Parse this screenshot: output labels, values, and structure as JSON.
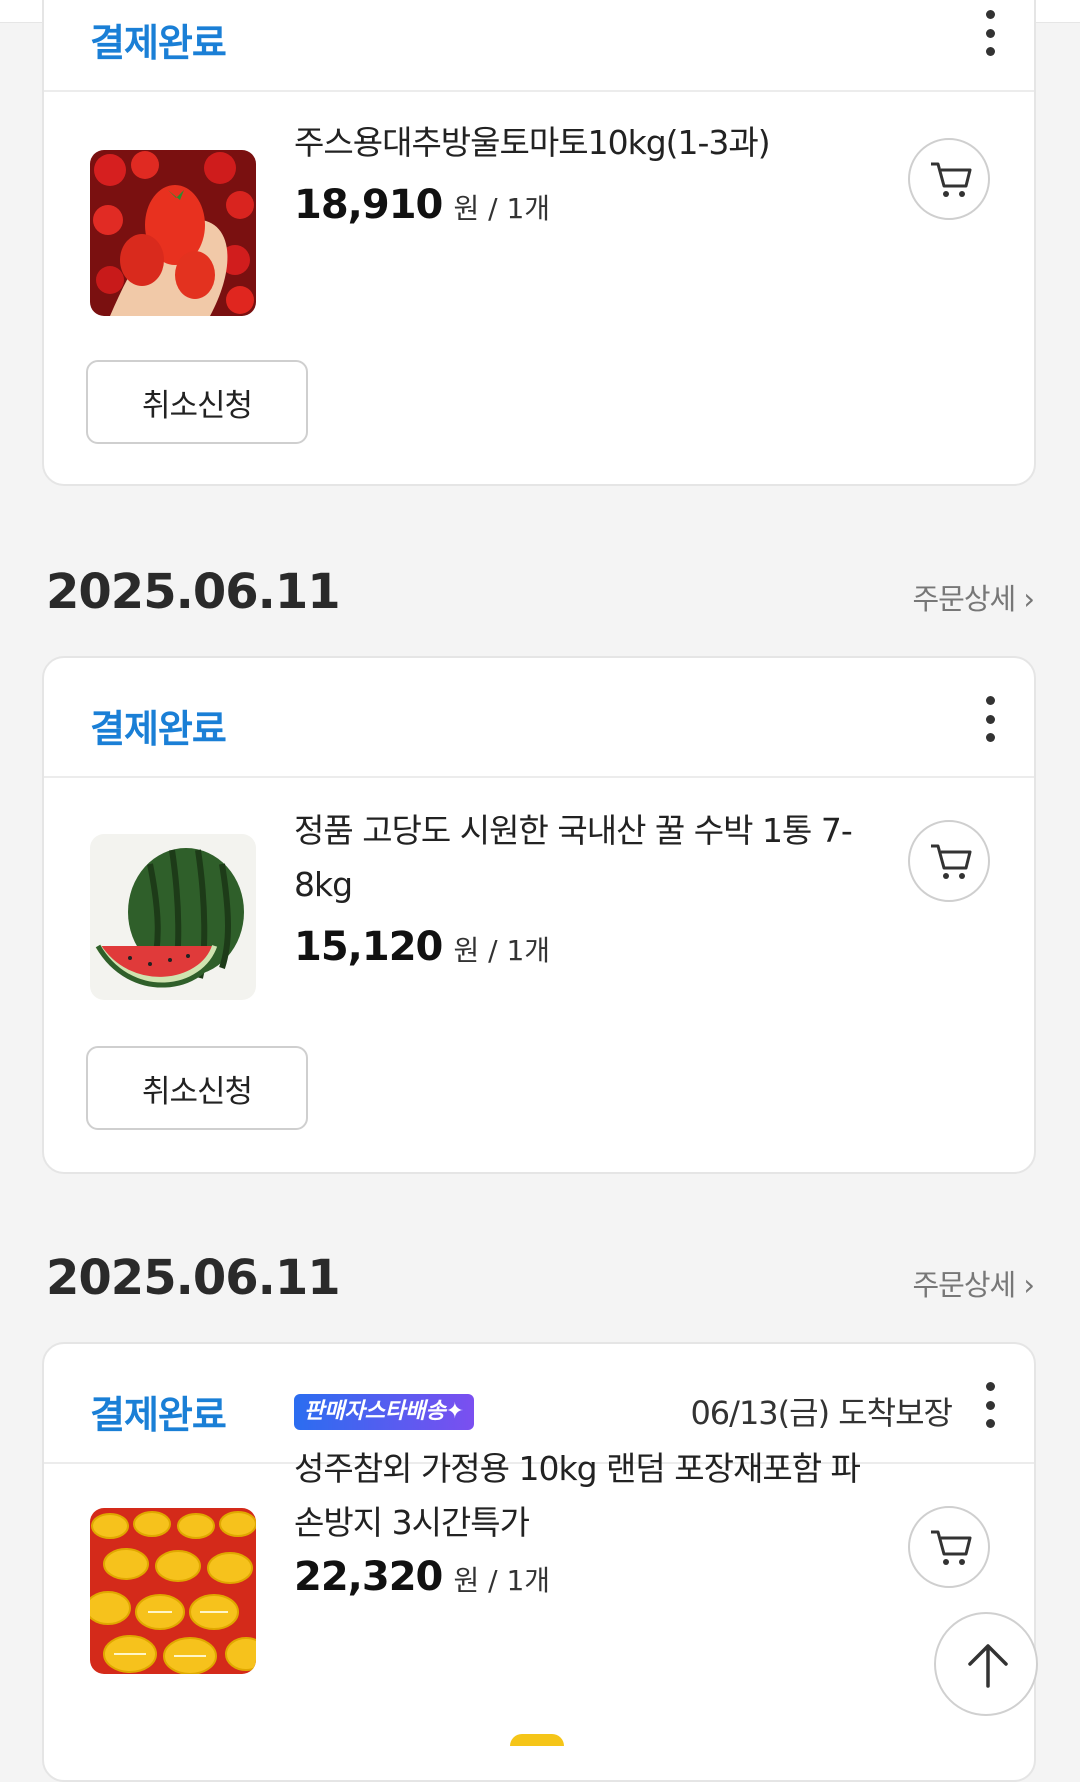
{
  "orders": [
    {
      "status": "결제완료",
      "product": {
        "name": "주스용대추방울토마토10kg(1-3과)",
        "price": "18,910",
        "unit": "원 / 1개",
        "image": "cherry-tomatoes"
      },
      "cancel_label": "취소신청"
    },
    {
      "date": "2025.06.11",
      "detail_label": "주문상세 ›",
      "status": "결제완료",
      "product": {
        "name": "정품 고당도 시원한 국내산 꿀 수박 1통 7-8kg",
        "price": "15,120",
        "unit": "원 / 1개",
        "image": "watermelon"
      },
      "cancel_label": "취소신청"
    },
    {
      "date": "2025.06.11",
      "detail_label": "주문상세 ›",
      "status": "결제완료",
      "guarantee": "06/13(금) 도착보장",
      "product": {
        "badge": "판매자스타배송✦",
        "name": "성주참외 가정용 10kg 랜덤 포장재포함 파손방지 3시간특가",
        "price": "22,320",
        "unit": "원 / 1개",
        "image": "korean-melons"
      }
    }
  ],
  "colors": {
    "status": "#1a7fd6",
    "badge_start": "#2b6df0",
    "badge_end": "#7b4ff0"
  },
  "icons": [
    "cart-icon",
    "kebab-menu-icon",
    "arrow-up-icon",
    "chevron-right-icon"
  ]
}
